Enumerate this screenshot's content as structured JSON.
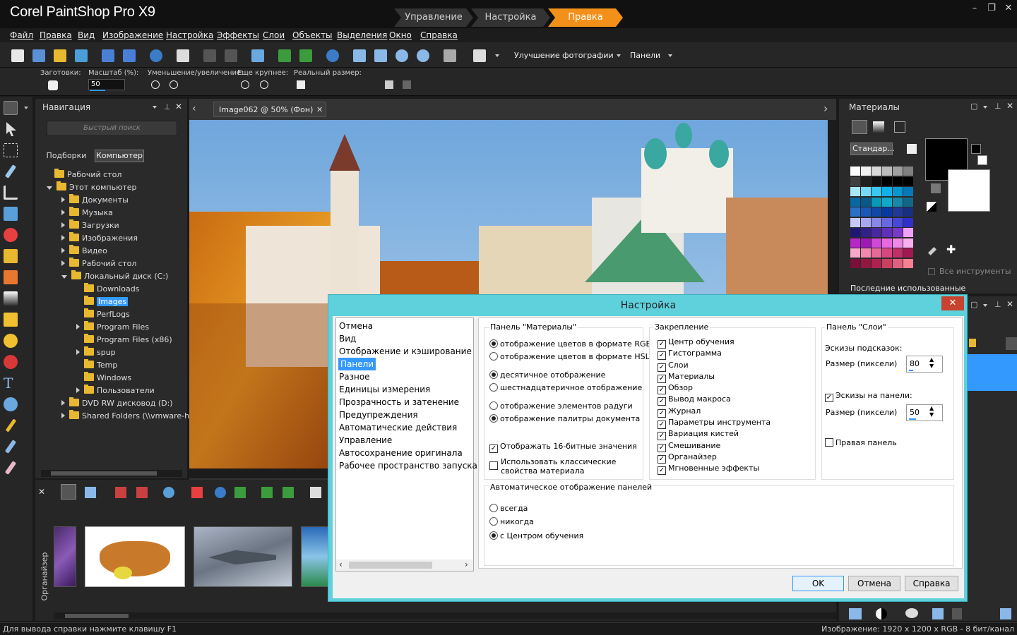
{
  "app": {
    "title": "Corel PaintShop Pro X9"
  },
  "workspace_tabs": [
    "Управление",
    "Настройка",
    "Правка"
  ],
  "window_controls": {
    "minimize": "–",
    "restore": "❐",
    "close": "✕"
  },
  "menu": [
    "Файл",
    "Правка",
    "Вид",
    "Изображение",
    "Настройка",
    "Эффекты",
    "Слои",
    "Объекты",
    "Выделения",
    "Окно",
    "Справка"
  ],
  "toolbar": {
    "photo_fix": "Улучшение фотографии",
    "panels": "Панели"
  },
  "options": {
    "presets": "Заготовки:",
    "zoom_label": "Масштаб (%):",
    "zoom_value": "50",
    "zoom_inout": "Уменьшение/увеличение:",
    "zoom_more": "Еще крупнее:",
    "actual_size": "Реальный размер:"
  },
  "navigation": {
    "title": "Навигация",
    "search_placeholder": "Быстрый поиск",
    "tabs": [
      "Подборки",
      "Компьютер"
    ],
    "tree": [
      {
        "label": "Рабочий стол",
        "level": 0,
        "arrow": ""
      },
      {
        "label": "Этот компьютер",
        "level": 0,
        "arrow": "down"
      },
      {
        "label": "Документы",
        "level": 1,
        "arrow": "right"
      },
      {
        "label": "Музыка",
        "level": 1,
        "arrow": "right"
      },
      {
        "label": "Загрузки",
        "level": 1,
        "arrow": "right"
      },
      {
        "label": "Изображения",
        "level": 1,
        "arrow": "right"
      },
      {
        "label": "Видео",
        "level": 1,
        "arrow": "right"
      },
      {
        "label": "Рабочий стол",
        "level": 1,
        "arrow": "right"
      },
      {
        "label": "Локальный диск (C:)",
        "level": 1,
        "arrow": "down"
      },
      {
        "label": "Downloads",
        "level": 2,
        "arrow": ""
      },
      {
        "label": "Images",
        "level": 2,
        "arrow": "",
        "selected": true
      },
      {
        "label": "PerfLogs",
        "level": 2,
        "arrow": ""
      },
      {
        "label": "Program Files",
        "level": 2,
        "arrow": "right"
      },
      {
        "label": "Program Files (x86)",
        "level": 2,
        "arrow": ""
      },
      {
        "label": "spup",
        "level": 2,
        "arrow": "right"
      },
      {
        "label": "Temp",
        "level": 2,
        "arrow": ""
      },
      {
        "label": "Windows",
        "level": 2,
        "arrow": ""
      },
      {
        "label": "Пользователи",
        "level": 2,
        "arrow": "right"
      },
      {
        "label": "DVD RW дисковод (D:)",
        "level": 1,
        "arrow": "right"
      },
      {
        "label": "Shared Folders (\\\\vmware-h",
        "level": 1,
        "arrow": "right"
      }
    ]
  },
  "document": {
    "tab_label": "Image062 @  50% (Фон)"
  },
  "organizer": {
    "label": "Органайзер"
  },
  "materials": {
    "title": "Материалы",
    "dropdown": "Стандар...",
    "all_tools": "Все инструменты",
    "recent": "Последние использованные"
  },
  "status": {
    "left": "Для вывода справки нажмите клавишу F1",
    "right": "Изображение:  1920 x 1200 x RGB - 8 бит/канал"
  },
  "dialog": {
    "title": "Настройка",
    "close": "✕",
    "categories": [
      "Отмена",
      "Вид",
      "Отображение и кэширование",
      "Панели",
      "Разное",
      "Единицы измерения",
      "Прозрачность и затенение",
      "Предупреждения",
      "Автоматические действия",
      "Управление",
      "Автосохранение оригинала",
      "Рабочее пространство запуска по"
    ],
    "selected_index": 3,
    "materials_group": {
      "title": "Панель \"Материалы\"",
      "rgb": "отображение цветов в формате RGB",
      "hsl": "отображение цветов в формате HSL",
      "decimal": "десятичное отображение",
      "hex": "шестнадцатеричное отображение",
      "rainbow": "отображение элементов радуги",
      "palette": "отображение палитры документа",
      "bits16": "Отображать 16-битные значения",
      "classic": "Использовать классические свойства материала"
    },
    "docking_group": {
      "title": "Закрепление",
      "items": [
        "Центр обучения",
        "Гистограмма",
        "Слои",
        "Материалы",
        "Обзор",
        "Вывод макроса",
        "Журнал",
        "Параметры инструмента",
        "Вариация кистей",
        "Смешивание",
        "Органайзер",
        "Мгновенные эффекты"
      ]
    },
    "layers_group": {
      "title": "Панель \"Слои\"",
      "tooltip_thumbs": "Эскизы подсказок:",
      "size_label": "Размер (пиксели)",
      "size1": "80",
      "panel_thumbs": "Эскизы на панели:",
      "size2": "50",
      "right_panel": "Правая панель"
    },
    "auto_group": {
      "title": "Автоматическое отображение панелей",
      "always": "всегда",
      "never": "никогда",
      "with_center": "с Центром обучения"
    },
    "buttons": {
      "ok": "OK",
      "cancel": "Отмена",
      "help": "Справка"
    }
  },
  "colors": {
    "accent": "#f39019",
    "dialog_frame": "#5ed1dd",
    "selection": "#3399ff",
    "close_red": "#c7432f"
  }
}
